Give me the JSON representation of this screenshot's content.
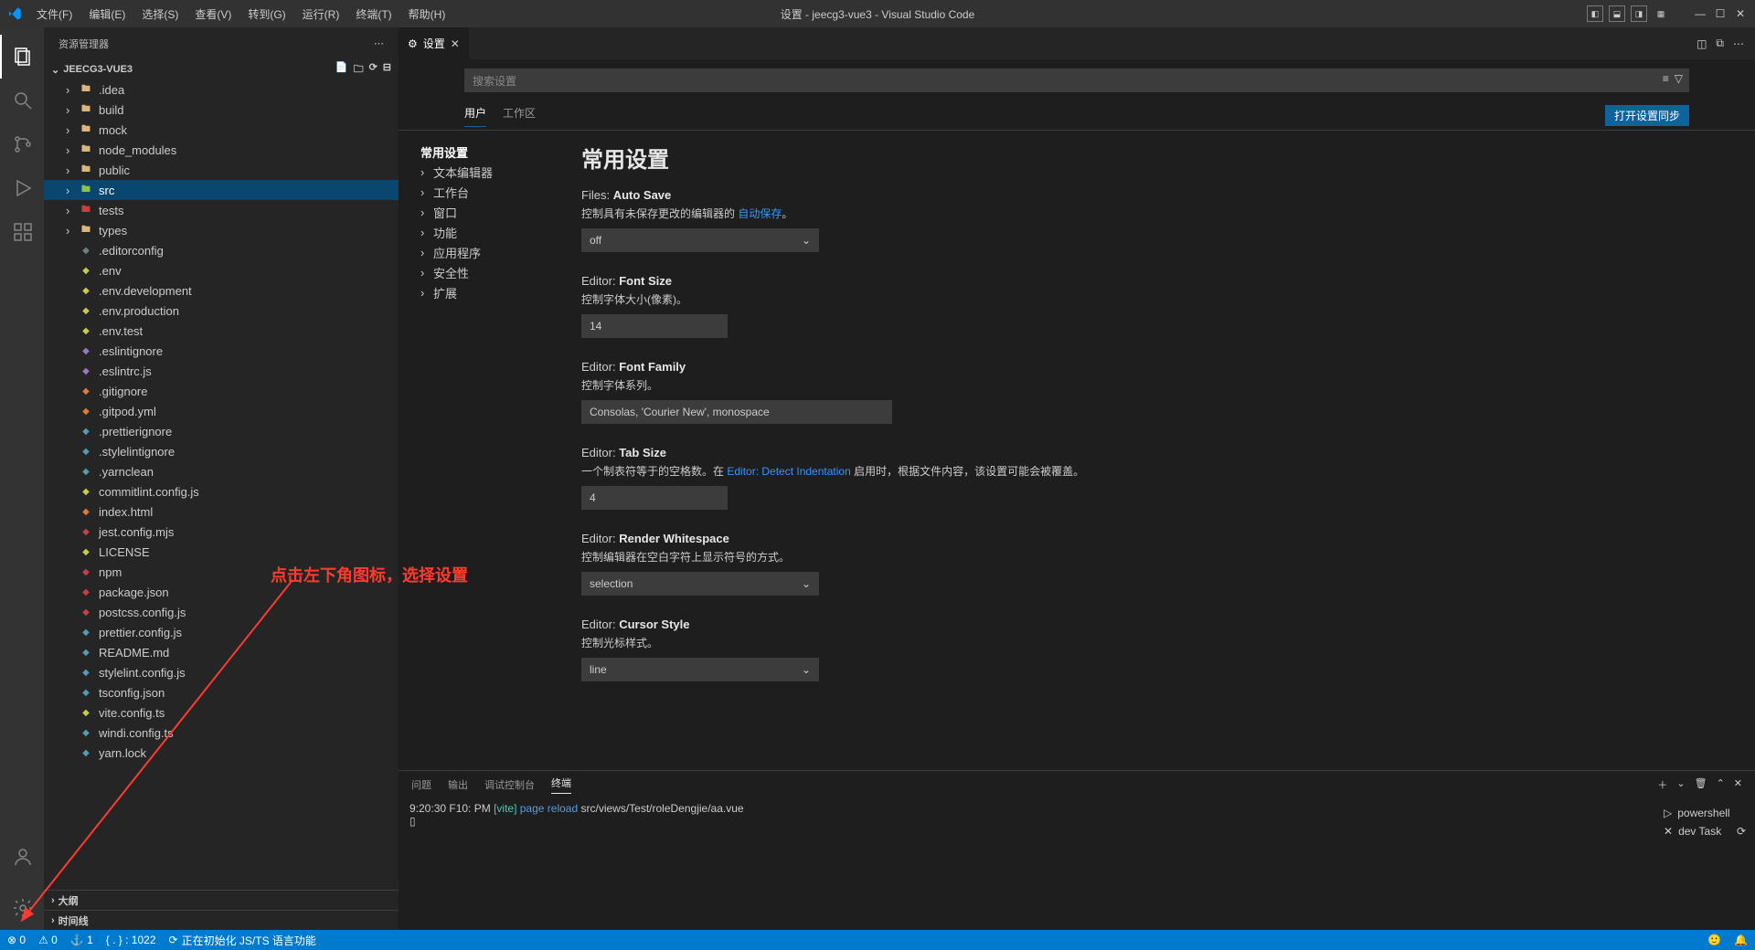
{
  "window_title": "设置 - jeecg3-vue3 - Visual Studio Code",
  "menus": [
    "文件(F)",
    "编辑(E)",
    "选择(S)",
    "查看(V)",
    "转到(G)",
    "运行(R)",
    "终端(T)",
    "帮助(H)"
  ],
  "sidebar": {
    "title": "资源管理器",
    "project": "JEECG3-VUE3",
    "outline": "大纲",
    "timeline": "时间线",
    "tree": [
      {
        "type": "folder",
        "name": ".idea"
      },
      {
        "type": "folder",
        "name": "build"
      },
      {
        "type": "folder",
        "name": "mock"
      },
      {
        "type": "folder",
        "name": "node_modules"
      },
      {
        "type": "folder",
        "name": "public"
      },
      {
        "type": "folder",
        "name": "src",
        "selected": true,
        "green": true
      },
      {
        "type": "folder",
        "name": "tests",
        "red": true
      },
      {
        "type": "folder",
        "name": "types"
      },
      {
        "type": "file",
        "name": ".editorconfig",
        "icon": "grey"
      },
      {
        "type": "file",
        "name": ".env",
        "icon": "yellow"
      },
      {
        "type": "file",
        "name": ".env.development",
        "icon": "yellow"
      },
      {
        "type": "file",
        "name": ".env.production",
        "icon": "yellow"
      },
      {
        "type": "file",
        "name": ".env.test",
        "icon": "yellow"
      },
      {
        "type": "file",
        "name": ".eslintignore",
        "icon": "purple"
      },
      {
        "type": "file",
        "name": ".eslintrc.js",
        "icon": "purple"
      },
      {
        "type": "file",
        "name": ".gitignore",
        "icon": "orange"
      },
      {
        "type": "file",
        "name": ".gitpod.yml",
        "icon": "orange"
      },
      {
        "type": "file",
        "name": ".prettierignore",
        "icon": "blue"
      },
      {
        "type": "file",
        "name": ".stylelintignore",
        "icon": "blue"
      },
      {
        "type": "file",
        "name": ".yarnclean",
        "icon": "blue"
      },
      {
        "type": "file",
        "name": "commitlint.config.js",
        "icon": "yellow"
      },
      {
        "type": "file",
        "name": "index.html",
        "icon": "orange"
      },
      {
        "type": "file",
        "name": "jest.config.mjs",
        "icon": "red"
      },
      {
        "type": "file",
        "name": "LICENSE",
        "icon": "yellow"
      },
      {
        "type": "file",
        "name": "npm",
        "icon": "red"
      },
      {
        "type": "file",
        "name": "package.json",
        "icon": "red"
      },
      {
        "type": "file",
        "name": "postcss.config.js",
        "icon": "red"
      },
      {
        "type": "file",
        "name": "prettier.config.js",
        "icon": "blue"
      },
      {
        "type": "file",
        "name": "README.md",
        "icon": "blue"
      },
      {
        "type": "file",
        "name": "stylelint.config.js",
        "icon": "blue"
      },
      {
        "type": "file",
        "name": "tsconfig.json",
        "icon": "blue"
      },
      {
        "type": "file",
        "name": "vite.config.ts",
        "icon": "yellow"
      },
      {
        "type": "file",
        "name": "windi.config.ts",
        "icon": "blue"
      },
      {
        "type": "file",
        "name": "yarn.lock",
        "icon": "blue"
      }
    ]
  },
  "tab": {
    "label": "设置"
  },
  "settings": {
    "search_placeholder": "搜索设置",
    "scopes": {
      "user": "用户",
      "workspace": "工作区"
    },
    "sync": "打开设置同步",
    "toc": [
      "常用设置",
      "文本编辑器",
      "工作台",
      "窗口",
      "功能",
      "应用程序",
      "安全性",
      "扩展"
    ],
    "heading": "常用设置",
    "items": {
      "autosave": {
        "scope": "Files:",
        "name": "Auto Save",
        "desc_prefix": "控制具有未保存更改的编辑器的 ",
        "desc_link": "自动保存",
        "desc_suffix": "。",
        "value": "off"
      },
      "fontsize": {
        "scope": "Editor:",
        "name": "Font Size",
        "desc": "控制字体大小(像素)。",
        "value": "14"
      },
      "fontfamily": {
        "scope": "Editor:",
        "name": "Font Family",
        "desc": "控制字体系列。",
        "value": "Consolas, 'Courier New', monospace"
      },
      "tabsize": {
        "scope": "Editor:",
        "name": "Tab Size",
        "desc_prefix": "一个制表符等于的空格数。在 ",
        "desc_link": "Editor: Detect Indentation",
        "desc_suffix": " 启用时，根据文件内容，该设置可能会被覆盖。",
        "value": "4"
      },
      "whitespace": {
        "scope": "Editor:",
        "name": "Render Whitespace",
        "desc": "控制编辑器在空白字符上显示符号的方式。",
        "value": "selection"
      },
      "cursor": {
        "scope": "Editor:",
        "name": "Cursor Style",
        "desc": "控制光标样式。",
        "value": "line"
      }
    }
  },
  "panel": {
    "tabs": [
      "问题",
      "输出",
      "调试控制台",
      "终端"
    ],
    "terminal": {
      "time": "9:20:30  F10: PM",
      "vite": "[vite]",
      "reload": "page reload",
      "path": "src/views/Test/roleDengjie/aa.vue"
    },
    "side": [
      {
        "icon": "▷",
        "label": "powershell"
      },
      {
        "icon": "✕",
        "label": "dev Task"
      }
    ]
  },
  "statusbar": {
    "errors": "⊗ 0",
    "warnings": "⚠ 0",
    "ports": "⚓ 1",
    "ln": "{ . } : 1022",
    "spinner": "⟳",
    "init": "正在初始化 JS/TS 语言功能"
  },
  "annotation": "点击左下角图标，选择设置"
}
